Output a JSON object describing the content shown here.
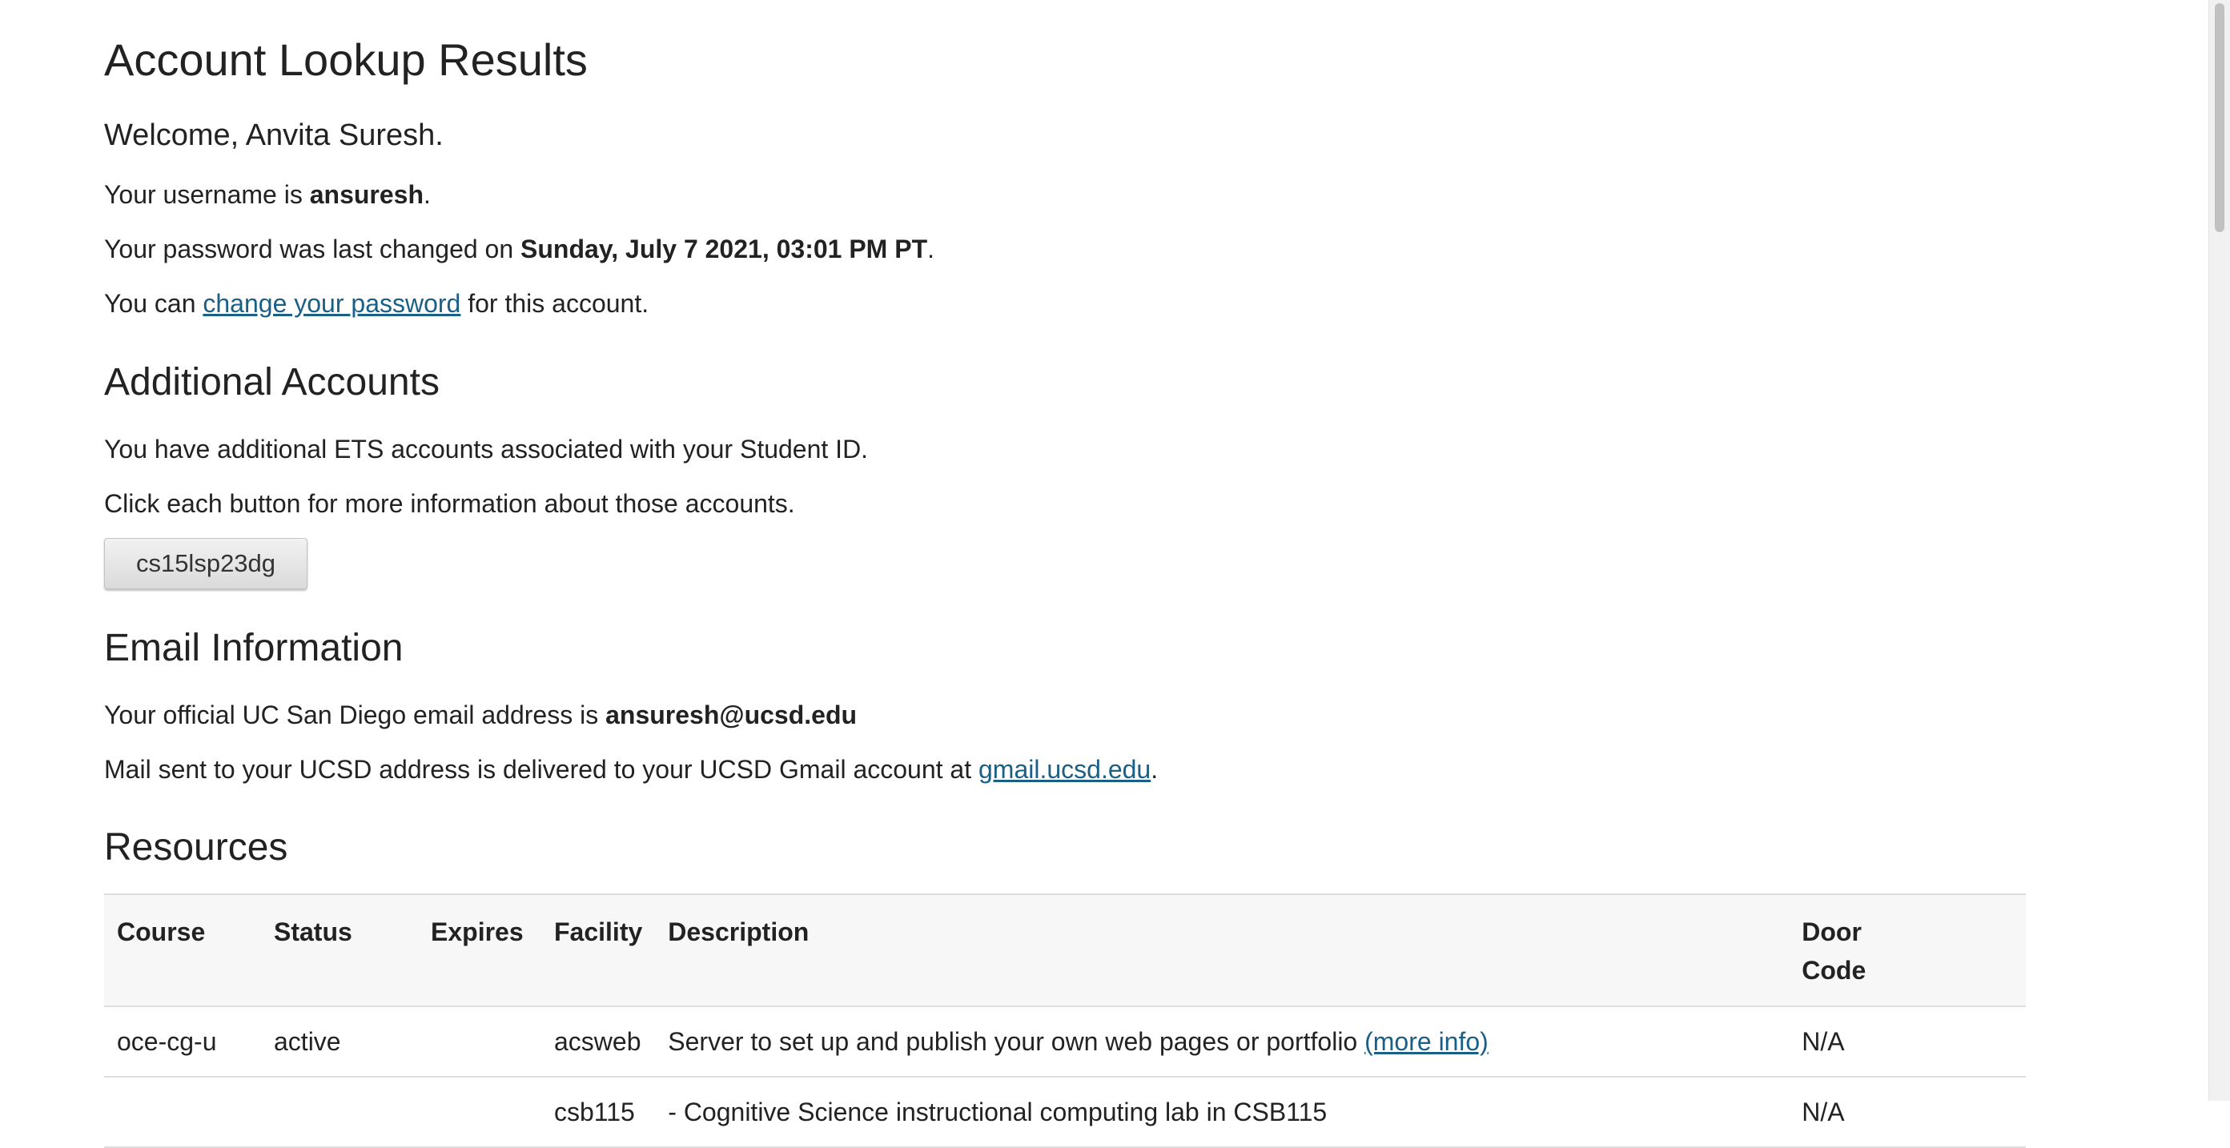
{
  "page": {
    "title": "Account Lookup Results",
    "welcome": "Welcome, Anvita Suresh.",
    "username_prefix": "Your username is ",
    "username": "ansuresh",
    "username_suffix": ".",
    "password_prefix": "Your password was last changed on ",
    "password_date": "Sunday, July 7 2021, 03:01 PM PT",
    "password_suffix": ".",
    "change_prefix": "You can ",
    "change_link": "change your password",
    "change_suffix": " for this account."
  },
  "additional": {
    "heading": "Additional Accounts",
    "line1": "You have additional ETS accounts associated with your Student ID.",
    "line2": "Click each button for more information about those accounts.",
    "button_label": "cs15lsp23dg"
  },
  "email": {
    "heading": "Email Information",
    "address_prefix": "Your official UC San Diego email address is ",
    "address": "ansuresh@ucsd.edu",
    "gmail_prefix": "Mail sent to your UCSD address is delivered to your UCSD Gmail account at ",
    "gmail_link": "gmail.ucsd.edu",
    "gmail_suffix": "."
  },
  "resources": {
    "heading": "Resources",
    "columns": {
      "course": "Course",
      "status": "Status",
      "expires": "Expires",
      "facility": "Facility",
      "description": "Description",
      "door_code_line1": "Door",
      "door_code_line2": "Code"
    },
    "rows": [
      {
        "course": "oce-cg-u",
        "status": "active",
        "expires": "",
        "facility": "acsweb",
        "description": "Server to set up and publish your own web pages or portfolio ",
        "more_info": "(more info)",
        "door_code": "N/A"
      },
      {
        "course": "",
        "status": "",
        "expires": "",
        "facility": "csb115",
        "description": "- Cognitive Science instructional computing lab in CSB115",
        "more_info": "",
        "door_code": "N/A"
      }
    ]
  }
}
